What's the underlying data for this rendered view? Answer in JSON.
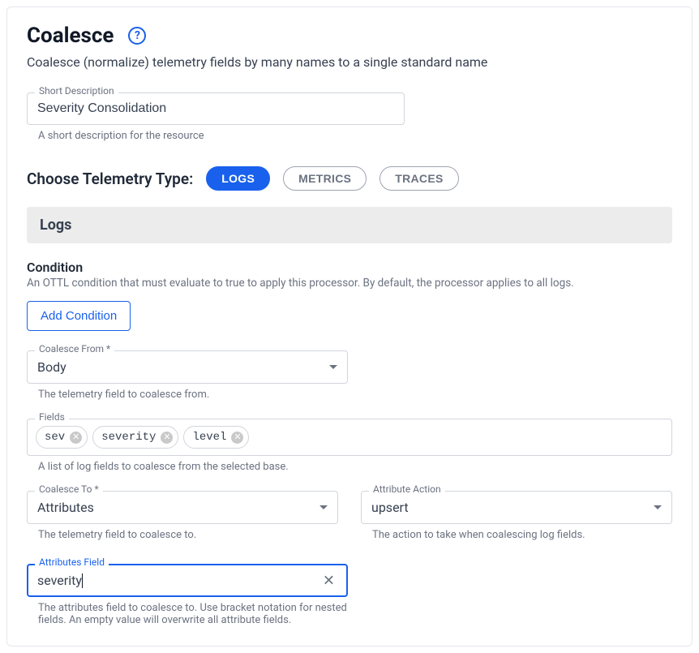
{
  "header": {
    "title": "Coalesce",
    "subtitle": "Coalesce (normalize) telemetry fields by many names to a single standard name"
  },
  "shortDescription": {
    "label": "Short Description",
    "value": "Severity Consolidation",
    "helper": "A short description for the resource"
  },
  "telemetry": {
    "label": "Choose Telemetry Type:",
    "options": [
      "LOGS",
      "METRICS",
      "TRACES"
    ],
    "active": "LOGS"
  },
  "sectionHeader": "Logs",
  "condition": {
    "heading": "Condition",
    "desc": "An OTTL condition that must evaluate to true to apply this processor. By default, the processor applies to all logs.",
    "button": "Add Condition"
  },
  "coalesceFrom": {
    "label": "Coalesce From",
    "value": "Body",
    "helper": "The telemetry field to coalesce from."
  },
  "fields": {
    "label": "Fields",
    "chips": [
      "sev",
      "severity",
      "level"
    ],
    "helper": "A list of log fields to coalesce from the selected base."
  },
  "coalesceTo": {
    "label": "Coalesce To",
    "value": "Attributes",
    "helper": "The telemetry field to coalesce to."
  },
  "attributeAction": {
    "label": "Attribute Action",
    "value": "upsert",
    "helper": "The action to take when coalescing log fields."
  },
  "attributesField": {
    "label": "Attributes Field",
    "value": "severity",
    "helper": "The attributes field to coalesce to. Use bracket notation for nested fields. An empty value will overwrite all attribute fields."
  }
}
